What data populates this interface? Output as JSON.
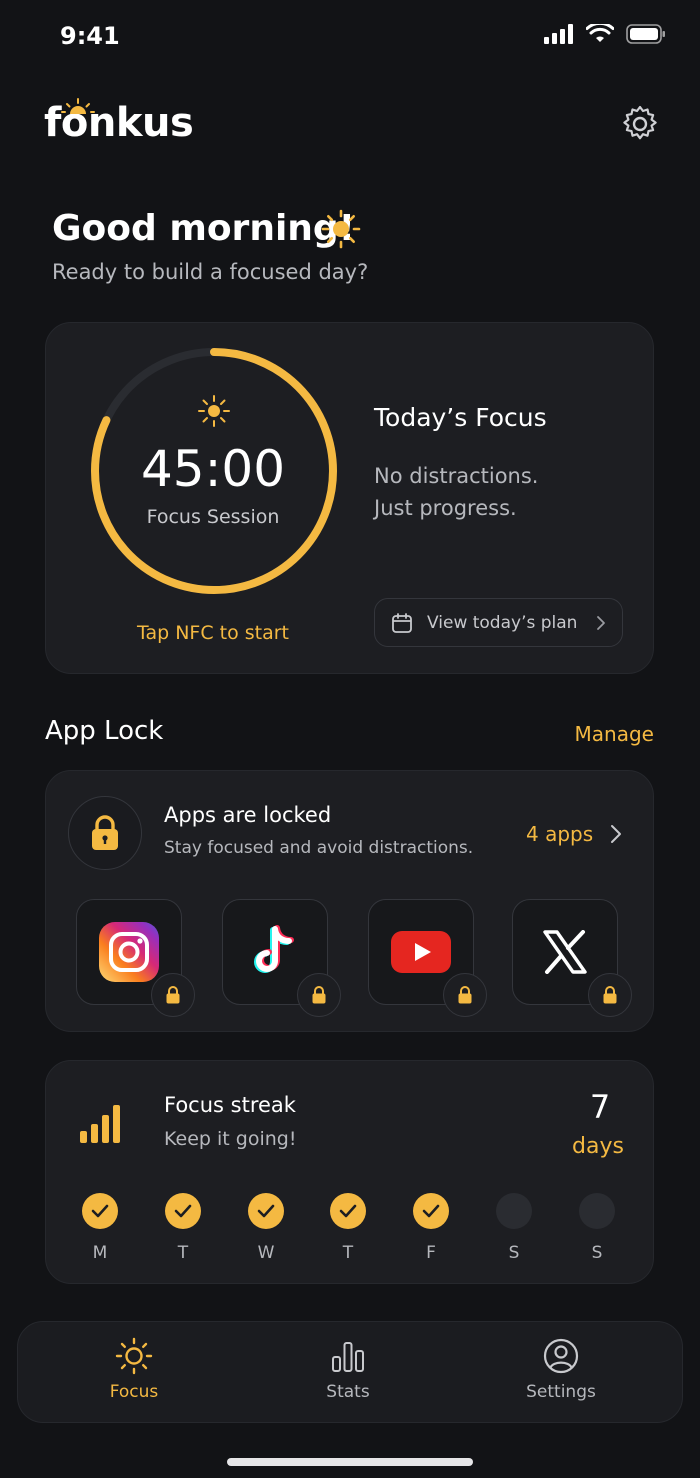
{
  "status": {
    "time": "9:41"
  },
  "header": {
    "logo": "fonkus"
  },
  "greeting": {
    "title": "Good morning!",
    "subtitle": "Ready to build a focused day?"
  },
  "focus": {
    "timer": "45:00",
    "timer_label": "Focus Session",
    "progress": 0.82,
    "nfc_hint": "Tap NFC to start",
    "today_title": "Today’s Focus",
    "line1": "No distractions.",
    "line2": "Just progress.",
    "plan_button": "View today’s plan"
  },
  "app_lock": {
    "section_title": "App Lock",
    "manage": "Manage",
    "status_title": "Apps are locked",
    "status_sub": "Stay focused and avoid distractions.",
    "count": "4 apps",
    "apps": [
      "instagram-icon",
      "tiktok-icon",
      "youtube-icon",
      "x-icon"
    ]
  },
  "streak": {
    "title": "Focus streak",
    "subtitle": "Keep it going!",
    "number": "7",
    "unit": "days",
    "days": [
      {
        "label": "M",
        "done": true
      },
      {
        "label": "T",
        "done": true
      },
      {
        "label": "W",
        "done": true
      },
      {
        "label": "T",
        "done": true
      },
      {
        "label": "F",
        "done": true
      },
      {
        "label": "S",
        "done": false
      },
      {
        "label": "S",
        "done": false
      }
    ]
  },
  "tabs": {
    "focus": "Focus",
    "stats": "Stats",
    "settings": "Settings"
  },
  "colors": {
    "accent": "#f4b942",
    "background": "#121316",
    "card": "#1d1e22"
  }
}
